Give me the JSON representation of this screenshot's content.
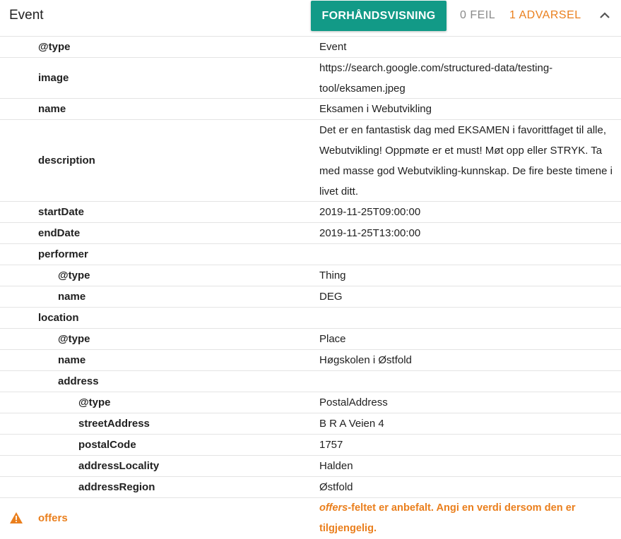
{
  "header": {
    "title": "Event",
    "preview_button": "FORHÅNDSVISNING",
    "errors": "0 FEIL",
    "warnings": "1 ADVARSEL"
  },
  "rows": [
    {
      "key": "@type",
      "value": "Event"
    },
    {
      "key": "image",
      "value": "https://search.google.com/structured-data/testing-tool/eksamen.jpeg"
    },
    {
      "key": "name",
      "value": "Eksamen i Webutvikling"
    },
    {
      "key": "description",
      "value": "Det er en fantastisk dag med EKSAMEN i favorittfaget til alle, Webutvikling! Oppmøte er et must! Møt opp eller STRYK. Ta med masse god Webutvikling-kunnskap. De fire beste timene i livet ditt."
    },
    {
      "key": "startDate",
      "value": "2019-11-25T09:00:00"
    },
    {
      "key": "endDate",
      "value": "2019-11-25T13:00:00"
    },
    {
      "key": "performer",
      "value": ""
    },
    {
      "key": "@type",
      "value": "Thing"
    },
    {
      "key": "name",
      "value": "DEG"
    },
    {
      "key": "location",
      "value": ""
    },
    {
      "key": "@type",
      "value": "Place"
    },
    {
      "key": "name",
      "value": "Høgskolen i Østfold"
    },
    {
      "key": "address",
      "value": ""
    },
    {
      "key": "@type",
      "value": "PostalAddress"
    },
    {
      "key": "streetAddress",
      "value": "B R A Veien 4"
    },
    {
      "key": "postalCode",
      "value": "1757"
    },
    {
      "key": "addressLocality",
      "value": "Halden"
    },
    {
      "key": "addressRegion",
      "value": "Østfold"
    }
  ],
  "warning": {
    "key": "offers",
    "field": "offers",
    "message": "-feltet er anbefalt. Angi en verdi dersom den er tilgjengelig."
  },
  "colors": {
    "accent": "#129a87",
    "warning": "#ea7f1d",
    "muted": "#8a8a8a"
  },
  "icons": {
    "collapse": "chevron-up-icon",
    "warning": "warning-triangle-icon"
  }
}
